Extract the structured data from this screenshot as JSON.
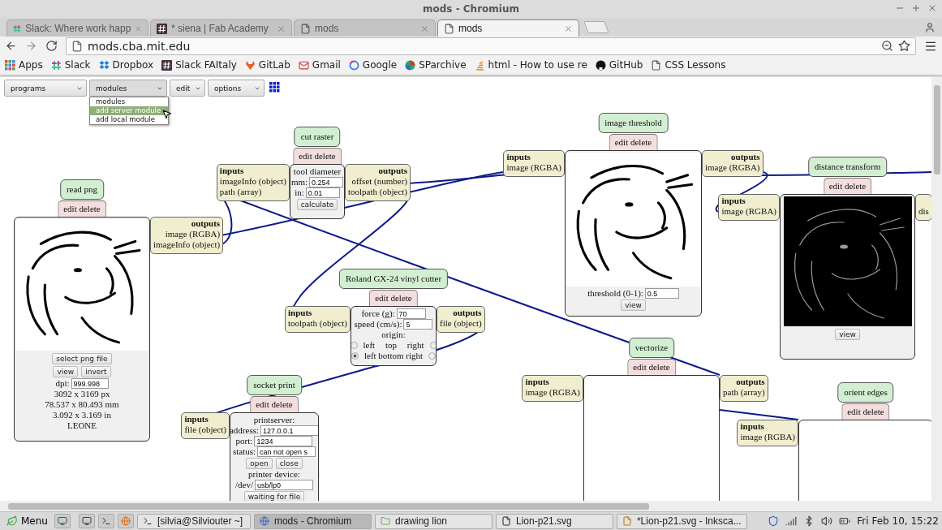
{
  "window": {
    "title": "mods - Chromium"
  },
  "tabs": [
    {
      "label": "Slack: Where work happ",
      "selected": false
    },
    {
      "label": "* siena | Fab Academy",
      "selected": false
    },
    {
      "label": "mods",
      "selected": false
    },
    {
      "label": "mods",
      "selected": true
    }
  ],
  "address": "mods.cba.mit.edu",
  "bookmarks": [
    "Apps",
    "Slack",
    "Dropbox",
    "Slack FAItaly",
    "GitLab",
    "Gmail",
    "Google",
    "SParchive",
    "html - How to use re",
    "GitHub",
    "CSS Lessons"
  ],
  "menus": [
    {
      "label": "programs",
      "open": false
    },
    {
      "label": "modules",
      "open": true,
      "options": [
        {
          "label": "modules",
          "selected": false
        },
        {
          "label": "add server module",
          "selected": true
        },
        {
          "label": "add local module",
          "selected": false
        }
      ]
    },
    {
      "label": "edit",
      "open": false
    },
    {
      "label": "options",
      "open": false
    }
  ],
  "modules": [
    {
      "title": "read png",
      "actions": "edit delete",
      "outputs": {
        "heading": "outputs",
        "ports": [
          "image (RGBA)",
          "imageInfo (object)"
        ]
      },
      "body": [
        {
          "kind": "picture"
        },
        {
          "kind": "buttons",
          "buttons": [
            "select png file"
          ]
        },
        {
          "kind": "buttons",
          "buttons": [
            "view",
            "invert"
          ]
        },
        {
          "kind": "field",
          "label": "dpi:",
          "value": "999.998"
        },
        {
          "kind": "text",
          "text": "3092 x 3169 px"
        },
        {
          "kind": "text",
          "text": "78.537 x 80.493 mm"
        },
        {
          "kind": "text",
          "text": "3.092 x 3.169 in"
        },
        {
          "kind": "text",
          "text": "LEONE"
        }
      ]
    },
    {
      "title": "cut raster",
      "actions": "edit delete",
      "inputs": {
        "heading": "inputs",
        "ports": [
          "imageInfo (object)",
          "path (array)"
        ]
      },
      "outputs": {
        "heading": "outputs",
        "ports": [
          "offset (number)",
          "toolpath (object)"
        ]
      },
      "body": [
        {
          "kind": "text",
          "text": "tool diameter"
        },
        {
          "kind": "field",
          "label": "mm:",
          "value": "0.254"
        },
        {
          "kind": "field",
          "label": "in:",
          "value": "0.01"
        },
        {
          "kind": "buttons",
          "buttons": [
            "calculate"
          ]
        }
      ]
    },
    {
      "title": "Roland GX-24 vinyl cutter",
      "actions": "edit delete",
      "inputs": {
        "heading": "inputs",
        "ports": [
          "toolpath (object)"
        ]
      },
      "outputs": {
        "heading": "outputs",
        "ports": [
          "file (object)"
        ]
      },
      "body": [
        {
          "kind": "field",
          "label": "force (g):",
          "value": "70"
        },
        {
          "kind": "field",
          "label": "speed (cm/s):",
          "value": "5"
        },
        {
          "kind": "text",
          "text": "origin:"
        },
        {
          "kind": "origin-row",
          "text": "left top right",
          "radios": [
            {
              "selected": false
            },
            {
              "selected": false
            }
          ]
        },
        {
          "kind": "origin-row",
          "text": "left bottom right",
          "radios": [
            {
              "selected": true
            },
            {
              "selected": false
            }
          ]
        }
      ]
    },
    {
      "title": "socket print",
      "actions": "edit delete",
      "inputs": {
        "heading": "inputs",
        "ports": [
          "file (object)"
        ]
      },
      "body": [
        {
          "kind": "text",
          "text": "printserver:"
        },
        {
          "kind": "field",
          "label": "address:",
          "value": "127.0.0.1"
        },
        {
          "kind": "field",
          "label": "port:",
          "value": "1234"
        },
        {
          "kind": "field",
          "label": "status:",
          "value": "can not open s"
        },
        {
          "kind": "buttons",
          "buttons": [
            "open",
            "close"
          ]
        },
        {
          "kind": "text",
          "text": "printer device:"
        },
        {
          "kind": "field",
          "label": "/dev/",
          "value": "usb/lp0"
        },
        {
          "kind": "buttons",
          "buttons": [
            "waiting for file"
          ]
        }
      ]
    },
    {
      "title": "image threshold",
      "actions": "edit delete",
      "inputs": {
        "heading": "inputs",
        "ports": [
          "image (RGBA)"
        ]
      },
      "outputs": {
        "heading": "outputs",
        "ports": [
          "image (RGBA)"
        ]
      },
      "body": [
        {
          "kind": "picture"
        },
        {
          "kind": "field",
          "label": "threshold (0-1):",
          "value": "0.5"
        },
        {
          "kind": "buttons",
          "buttons": [
            "view"
          ]
        }
      ]
    },
    {
      "title": "distance transform",
      "actions": "edit delete",
      "inputs": {
        "heading": "inputs",
        "ports": [
          "image (RGBA)"
        ]
      },
      "outputs": {
        "ports": [
          "dis"
        ]
      },
      "body": [
        {
          "kind": "dark-picture"
        },
        {
          "kind": "buttons",
          "buttons": [
            "view"
          ]
        }
      ]
    },
    {
      "title": "vectorize",
      "actions": "edit delete",
      "inputs": {
        "heading": "inputs",
        "ports": [
          "image (RGBA)"
        ]
      },
      "outputs": {
        "heading": "outputs",
        "ports": [
          "path (array)"
        ]
      },
      "body": [
        {
          "kind": "blank"
        }
      ]
    },
    {
      "title": "orient edges",
      "actions": "edit delete",
      "inputs": {
        "heading": "inputs",
        "ports": [
          "image (RGBA)"
        ]
      },
      "body": [
        {
          "kind": "blank"
        }
      ]
    }
  ],
  "taskbar": {
    "menu": "Menu",
    "tasks": [
      {
        "label": "[silvia@Silviouter ~]",
        "selected": false
      },
      {
        "label": "mods - Chromium",
        "selected": true
      },
      {
        "label": "drawing lion",
        "selected": false
      },
      {
        "label": "Lion-p21.svg",
        "selected": false
      },
      {
        "label": "*Lion-p21.svg - Inksca...",
        "selected": false
      }
    ],
    "clock": "Fri Feb 10, 15:22"
  }
}
